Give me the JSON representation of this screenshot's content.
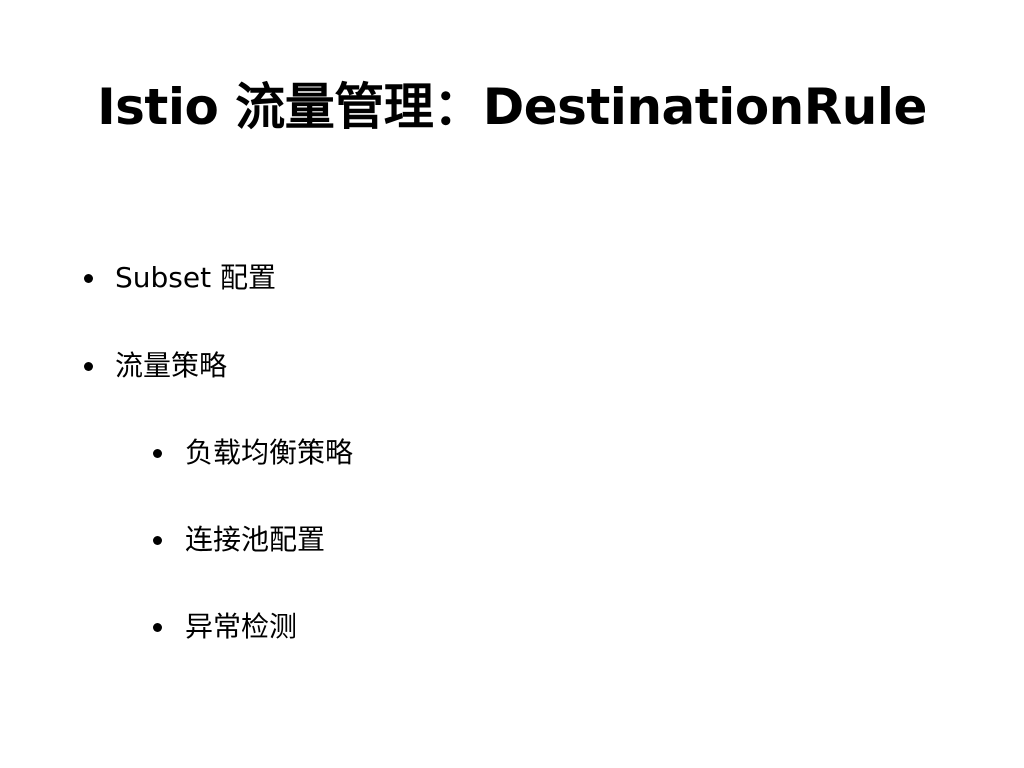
{
  "slide": {
    "title": "Istio 流量管理：DestinationRule",
    "bullets": [
      {
        "text": "Subset 配置",
        "level": 1
      },
      {
        "text": "流量策略",
        "level": 1
      },
      {
        "text": "负载均衡策略",
        "level": 2
      },
      {
        "text": "连接池配置",
        "level": 2
      },
      {
        "text": "异常检测",
        "level": 2
      }
    ]
  }
}
